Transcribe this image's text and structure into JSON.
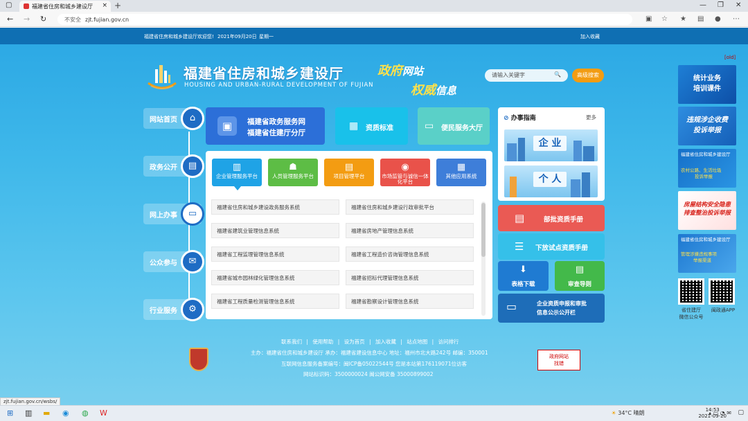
{
  "browser": {
    "tab_title": "福建省住房和城乡建设厅",
    "new_tab": "+",
    "win_min": "—",
    "win_max": "❐",
    "win_close": "✕",
    "not_secure": "不安全",
    "url": "zjt.fujian.gov.cn",
    "status_url": "zjt.fujian.gov.cn/wsbs/"
  },
  "topbar": {
    "welcome": "福建省住房和城乡建设厅欢迎您!",
    "date": "2021年09月20日",
    "weekday": "星期一",
    "bookmark": "加入收藏",
    "corner": "[old]"
  },
  "header": {
    "title_cn": "福建省住房和城乡建设厅",
    "title_en": "HOUSING AND URBAN-RURAL DEVELOPMENT OF FUJIAN",
    "slogan_y1": "政府",
    "slogan_w1": "网站",
    "slogan_y2": "权威",
    "slogan_w2": "信息",
    "search_placeholder": "请输入关键字",
    "search_icon": "🔍",
    "adv_search": "高级搜索"
  },
  "left_nav": [
    {
      "label": "网站首页",
      "icon": "⌂",
      "active": false
    },
    {
      "label": "政务公开",
      "icon": "▤",
      "active": false
    },
    {
      "label": "网上办事",
      "icon": "▭",
      "active": true
    },
    {
      "label": "公众参与",
      "icon": "✉",
      "active": false
    },
    {
      "label": "行业服务",
      "icon": "⚙",
      "active": false
    }
  ],
  "tiles": {
    "gov_line1": "福建省政务服务网",
    "gov_line2": "福建省住建厅分厅",
    "gov_icon": "▣",
    "qual_label": "资质标准",
    "qual_icon": "▦",
    "conv_label": "便民服务大厅",
    "conv_icon": "▭"
  },
  "panel_tabs": [
    {
      "label": "企业管理服务平台",
      "icon": "▥"
    },
    {
      "label": "人员管理服务平台",
      "icon": "☗"
    },
    {
      "label": "项目管理平台",
      "icon": "▤"
    },
    {
      "label": "市场监管与诚信一体化平台",
      "icon": "◉"
    },
    {
      "label": "其他应用系统",
      "icon": "▦"
    }
  ],
  "panel_items": [
    "福建省住房和城乡建设政务服务系统",
    "福建省住房和城乡建设行政审批平台",
    "福建省建筑业管理信息系统",
    "福建省房地产管理信息系统",
    "福建省工程监理管理信息系统",
    "福建省工程造价咨询管理信息系统",
    "福建省城市园林绿化管理信息系统",
    "福建省招标代理管理信息系统",
    "福建省工程质量检测管理信息系统",
    "福建省勘察设计管理信息系统"
  ],
  "guide": {
    "title": "办事指南",
    "more": "更多",
    "enterprise": "企 业",
    "personal": "个 人"
  },
  "right_buttons": {
    "b1": "部批资质手册",
    "b1_icon": "▤",
    "b2": "下放试点资质手册",
    "b2_icon": "☰",
    "b3": "表格下载",
    "b3_icon": "⬇",
    "b4": "审查导则",
    "b4_icon": "▤",
    "b5_line1": "企业资质申报和审批",
    "b5_line2": "信息公示公开栏",
    "b5_icon": "▭"
  },
  "banners": {
    "b1_l1": "统计业务",
    "b1_l2": "培训课件",
    "b2_l1": "违规涉企收费",
    "b2_l2": "投诉举报",
    "b3_l1": "福建省住房和城乡建设厅",
    "b3_l2": "农村公路、生活垃圾",
    "b3_l3": "投诉举报",
    "b4_l1": "房屋结构安全隐患",
    "b4_l2": "排查整治投诉举报",
    "b5_l1": "福建省住房和城乡建设厅",
    "b5_l2": "管理涉嫌违规事项",
    "b5_l3": "举报渠道",
    "qr1_label_l1": "省住建厅",
    "qr1_label_l2": "微信公众号",
    "qr2_label": "闽政通APP"
  },
  "footer": {
    "links": [
      "联系我们",
      "|",
      "使用帮助",
      "|",
      "设为首页",
      "|",
      "加入收藏",
      "|",
      "站点地图",
      "|",
      "访问排行"
    ],
    "line1": "主办：福建省住房和城乡建设厅  承办：福建省建设信息中心  地址：福州市北大路242号  邮编：350001",
    "line2": "互联网信息服务备案编号：闽ICP备05022544号  您是本站第176119071位访客",
    "line3": "网站标识码：3500000024     闽公网安备 35000899002",
    "error_l1": "政府网站",
    "error_l2": "找错"
  },
  "taskbar": {
    "weather": "34°C 晴朗",
    "time": "14:53",
    "date": "2021-09-20"
  }
}
